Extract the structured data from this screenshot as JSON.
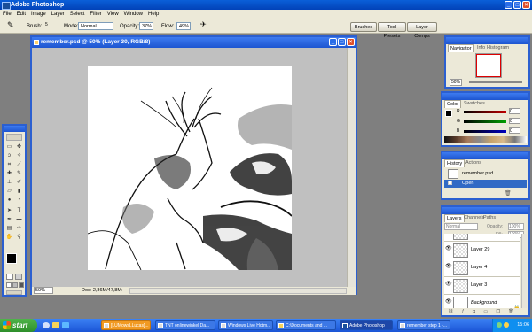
{
  "app": {
    "title": "Adobe Photoshop"
  },
  "menu": [
    "File",
    "Edit",
    "Image",
    "Layer",
    "Select",
    "Filter",
    "View",
    "Window",
    "Help"
  ],
  "options": {
    "brush_label": "Brush:",
    "brush_size": "5",
    "mode_label": "Mode:",
    "mode_value": "Normal",
    "opacity_label": "Opacity:",
    "opacity_value": "37%",
    "flow_label": "Flow:",
    "flow_value": "49%"
  },
  "workspace_tabs": [
    "Brushes",
    "Tool Presets",
    "Layer Comps"
  ],
  "document": {
    "title": "remember.psd @ 50% (Layer 30, RGB/8)",
    "zoom": "50%",
    "doc_info": "Doc: 2,86M/47,8M"
  },
  "navigator": {
    "tabs": [
      "Navigator",
      "Info",
      "Histogram"
    ],
    "zoom": "50%"
  },
  "color": {
    "tabs": [
      "Color",
      "Swatches"
    ],
    "channels": [
      {
        "label": "R",
        "value": "0",
        "color": "#c00000"
      },
      {
        "label": "G",
        "value": "0",
        "color": "#00a000"
      },
      {
        "label": "B",
        "value": "0",
        "color": "#0000c0"
      }
    ]
  },
  "history": {
    "tabs": [
      "History",
      "Actions"
    ],
    "items": [
      "remember.psd",
      "Open"
    ],
    "active": 1
  },
  "layers": {
    "tabs": [
      "Layers",
      "Channels",
      "Paths"
    ],
    "blend_mode": "Normal",
    "opacity_label": "Opacity:",
    "opacity_value": "100%",
    "fill_label": "Fill:",
    "fill_value": "100%",
    "rows": [
      "Layer 3",
      "Layer 29",
      "Layer 4",
      "Layer 3",
      "Background"
    ]
  },
  "taskbar": {
    "start": "start",
    "tasks": [
      "[LUMowsLLucas]...",
      "TNT onlinewinkel Da...",
      "Windows Live Hotm...",
      "C:\\Documents and ...",
      "Adobe Photoshop",
      "remember step 1 -..."
    ],
    "active_task": 4,
    "clock": "15:06"
  },
  "colors": {
    "accent": "#2b5fd0",
    "taskbar": "#245edb",
    "start": "#3a9c35"
  }
}
